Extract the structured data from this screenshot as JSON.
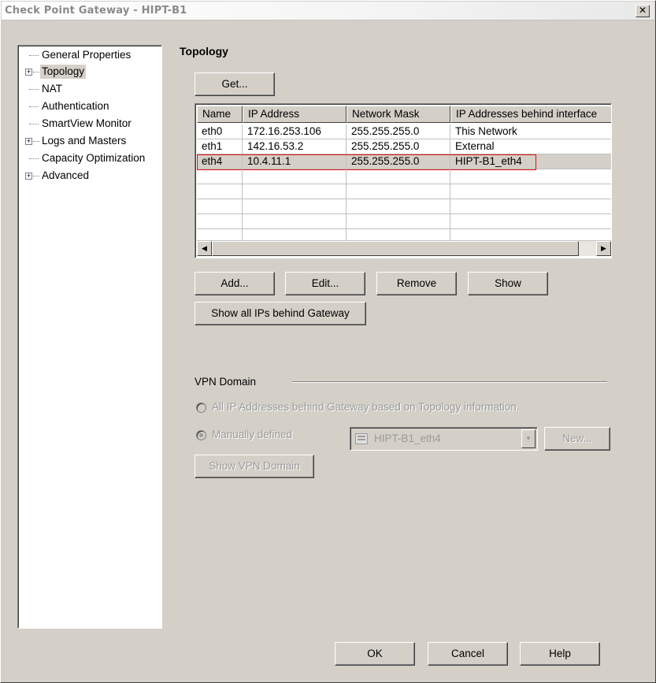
{
  "window": {
    "title": "Check Point Gateway - HIPT-B1",
    "close_glyph": "✕"
  },
  "tree": {
    "items": [
      {
        "label": "General Properties",
        "expandable": false
      },
      {
        "label": "Topology",
        "expandable": true,
        "selected": true
      },
      {
        "label": "NAT",
        "expandable": false
      },
      {
        "label": "Authentication",
        "expandable": false
      },
      {
        "label": "SmartView Monitor",
        "expandable": false
      },
      {
        "label": "Logs and Masters",
        "expandable": true
      },
      {
        "label": "Capacity Optimization",
        "expandable": false
      },
      {
        "label": "Advanced",
        "expandable": true
      }
    ]
  },
  "topology": {
    "title": "Topology",
    "get_button": "Get...",
    "columns": [
      "Name",
      "IP Address",
      "Network Mask",
      "IP Addresses behind interface"
    ],
    "rows": [
      [
        "eth0",
        "172.16.253.106",
        "255.255.255.0",
        "This Network"
      ],
      [
        "eth1",
        "142.16.53.2",
        "255.255.255.0",
        "External"
      ],
      [
        "eth4",
        "10.4.11.1",
        "255.255.255.0",
        "HIPT-B1_eth4"
      ]
    ],
    "selected_row": 2,
    "highlight_color": "#e01010",
    "buttons": {
      "add": "Add...",
      "edit": "Edit...",
      "remove": "Remove",
      "show": "Show"
    },
    "show_all_ips": "Show all IPs behind Gateway"
  },
  "vpn": {
    "group_label": "VPN Domain",
    "radio_all": "All IP Addresses behind Gateway based on Topology information.",
    "radio_manual": "Manually defined",
    "manual_selected": true,
    "combo_value": "HIPT-B1_eth4",
    "new_button": "New...",
    "show_vpn_domain": "Show VPN Domain",
    "disabled": true
  },
  "footer": {
    "ok": "OK",
    "cancel": "Cancel",
    "help": "Help"
  },
  "colors": {
    "face": "#d4d0c8",
    "disabled_text": "#9a9a9a",
    "title_text": "#8a8a8a"
  }
}
